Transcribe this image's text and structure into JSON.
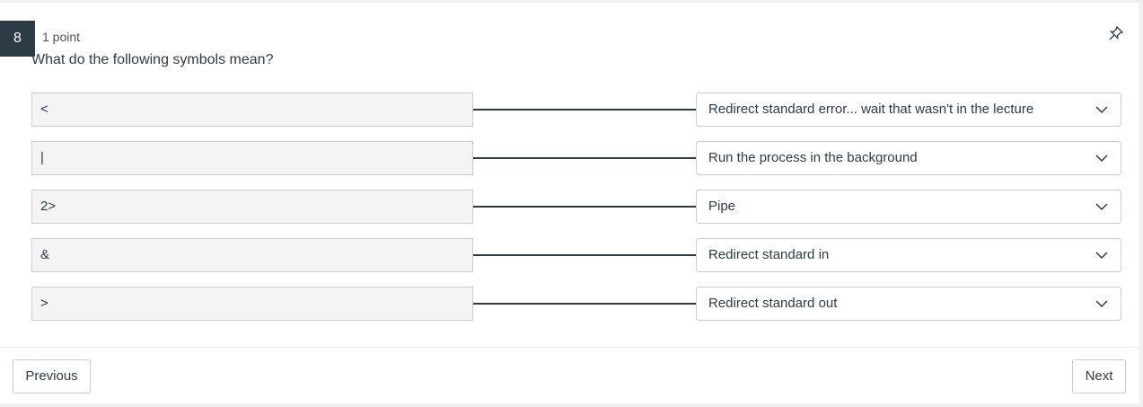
{
  "question": {
    "number": "8",
    "points": "1 point",
    "text": "What do the following symbols mean?"
  },
  "matches": [
    {
      "prompt": "<",
      "answer": "Redirect standard error... wait that wasn't in the lecture"
    },
    {
      "prompt": "|",
      "answer": "Run the process in the background"
    },
    {
      "prompt": "2>",
      "answer": "Pipe"
    },
    {
      "prompt": "&",
      "answer": "Redirect standard in"
    },
    {
      "prompt": ">",
      "answer": "Redirect standard out"
    }
  ],
  "nav": {
    "previous_label": "Previous",
    "next_label": "Next"
  },
  "icons": {
    "pin": "pin-icon",
    "dropdown": "chevron-down-icon"
  },
  "colors": {
    "badge": "#2d3b45",
    "text": "#2d3b45",
    "prompt_bg": "#f4f4f4",
    "border": "#c7cdd1"
  }
}
